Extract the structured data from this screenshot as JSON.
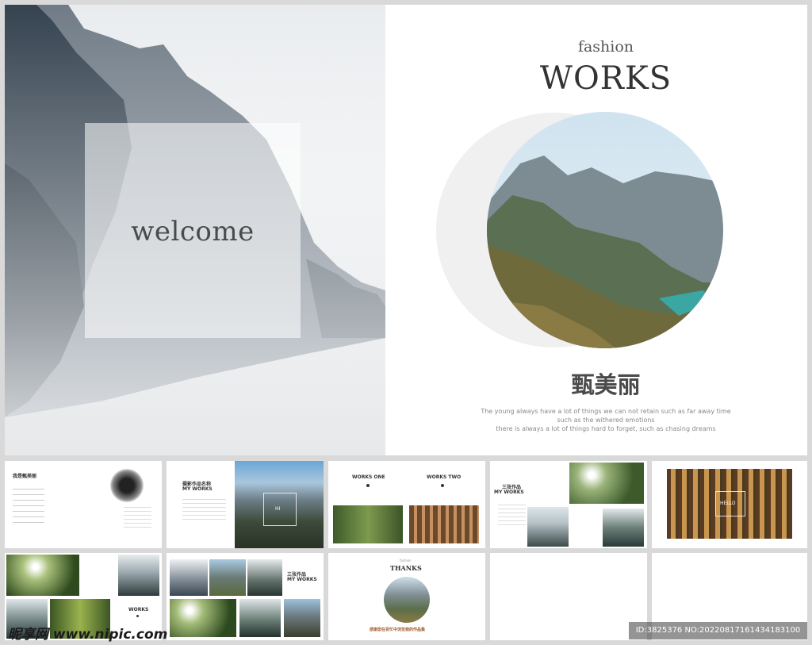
{
  "main_slide": {
    "welcome_text": "welcome",
    "fashion_label": "fashion",
    "works_title": "WORKS",
    "cn_title": "甄美丽",
    "paragraph": [
      "The young always have a lot of things we can not retain  such as far away time",
      "such as the withered  emotions",
      "there is always a lot of things hard to forget, such as chasing dreams"
    ]
  },
  "thumbnails": {
    "t1_title": "我是甄美丽",
    "t2_title_cn": "摄影作品名称",
    "t2_title_en": "MY WORKS",
    "t2_photo_label": "HI",
    "t3_left": "WORKS ONE",
    "t3_right": "WORKS TWO",
    "t4_title_cn": "三张作品",
    "t4_title_en": "MY WORKS",
    "t5_label": "HELLO",
    "t6_label": "WORKS",
    "t7_title_cn": "三张作品",
    "t7_title_en": "MY WORKS",
    "t8_small": "fashion",
    "t8_title": "THANKS",
    "t8_footer": "感谢您在百忙中浏览我的作品集"
  },
  "watermark": {
    "left": "昵享网 www.nipic.com",
    "right": "ID:3825376 NO:20220817161434183100"
  },
  "colors": {
    "background": "#d9d9d9",
    "title": "#333333",
    "text_gray": "#8a8a8a"
  }
}
